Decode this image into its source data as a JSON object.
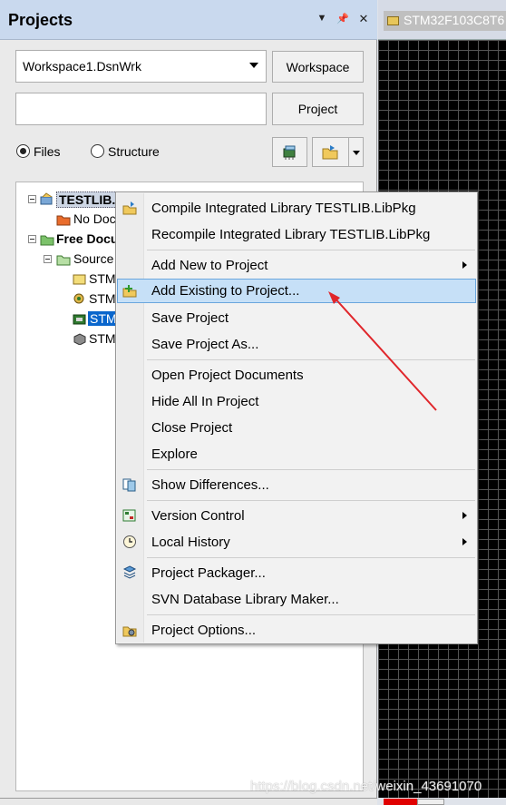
{
  "panel": {
    "title": "Projects",
    "workspace_combo_value": "Workspace1.DsnWrk",
    "workspace_button": "Workspace",
    "project_input_value": "",
    "project_button": "Project",
    "radio_files": "Files",
    "radio_structure": "Structure",
    "selected_view": "Files"
  },
  "tree": {
    "project_node": "TESTLIB.Li",
    "no_doc": "No Doc",
    "free_docs": "Free Docu",
    "source": "Source",
    "items": [
      "STM",
      "STM",
      "STM",
      "STM"
    ]
  },
  "doc_tab": {
    "label": "STM32F103C8T6"
  },
  "menu": {
    "items": [
      {
        "label": "Compile Integrated Library TESTLIB.LibPkg",
        "icon": "compile-icon"
      },
      {
        "label": "Recompile Integrated Library TESTLIB.LibPkg",
        "icon": ""
      },
      {
        "label": "Add New to Project",
        "icon": "",
        "submenu": true
      },
      {
        "label": "Add Existing to Project...",
        "icon": "add-existing-icon",
        "highlighted": true
      },
      {
        "label": "Save Project",
        "icon": ""
      },
      {
        "label": "Save Project As...",
        "icon": ""
      },
      {
        "label": "Open Project Documents",
        "icon": ""
      },
      {
        "label": "Hide All In Project",
        "icon": ""
      },
      {
        "label": "Close Project",
        "icon": ""
      },
      {
        "label": "Explore",
        "icon": ""
      },
      {
        "label": "Show Differences...",
        "icon": "differences-icon"
      },
      {
        "label": "Version Control",
        "icon": "version-control-icon",
        "submenu": true
      },
      {
        "label": "Local History",
        "icon": "history-icon",
        "submenu": true
      },
      {
        "label": "Project Packager...",
        "icon": "packager-icon"
      },
      {
        "label": "SVN Database Library Maker...",
        "icon": ""
      },
      {
        "label": "Project Options...",
        "icon": "options-icon"
      }
    ]
  },
  "watermark": "https://blog.csdn.net/weixin_43691070",
  "colors": {
    "header_bg": "#c9d9ee",
    "selection": "#0a66cc",
    "menu_highlight": "#c6e0f7",
    "annotation_arrow": "#e0262b"
  }
}
